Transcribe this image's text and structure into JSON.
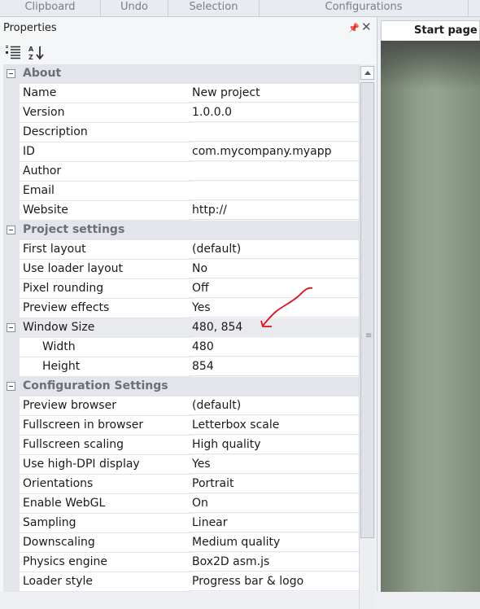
{
  "ribbon": {
    "tabs": [
      {
        "label": "Clipboard"
      },
      {
        "label": "Undo"
      },
      {
        "label": "Selection"
      },
      {
        "label": "Configurations"
      }
    ]
  },
  "properties": {
    "title": "Properties",
    "pin_icon": "pin-icon",
    "close_icon": "close-icon",
    "toolbar": [
      "categorized-view-icon",
      "alphabetical-sort-icon"
    ]
  },
  "groups": {
    "about": {
      "label": "About",
      "rows": [
        {
          "name": "Name",
          "value": "New project"
        },
        {
          "name": "Version",
          "value": "1.0.0.0"
        },
        {
          "name": "Description",
          "value": ""
        },
        {
          "name": "ID",
          "value": "com.mycompany.myapp"
        },
        {
          "name": "Author",
          "value": ""
        },
        {
          "name": "Email",
          "value": ""
        },
        {
          "name": "Website",
          "value": "http://"
        }
      ]
    },
    "project": {
      "label": "Project settings",
      "rows": [
        {
          "name": "First layout",
          "value": "(default)"
        },
        {
          "name": "Use loader layout",
          "value": "No"
        },
        {
          "name": "Pixel rounding",
          "value": "Off"
        },
        {
          "name": "Preview effects",
          "value": "Yes"
        }
      ],
      "window_size": {
        "name": "Window Size",
        "value": "480, 854"
      },
      "sub_rows": [
        {
          "name": "Width",
          "value": "480"
        },
        {
          "name": "Height",
          "value": "854"
        }
      ]
    },
    "config": {
      "label": "Configuration Settings",
      "rows": [
        {
          "name": "Preview browser",
          "value": "(default)"
        },
        {
          "name": "Fullscreen in browser",
          "value": "Letterbox scale"
        },
        {
          "name": "Fullscreen scaling",
          "value": "High quality"
        },
        {
          "name": "Use high-DPI display",
          "value": "Yes"
        },
        {
          "name": "Orientations",
          "value": "Portrait"
        },
        {
          "name": "Enable WebGL",
          "value": "On"
        },
        {
          "name": "Sampling",
          "value": "Linear"
        },
        {
          "name": "Downscaling",
          "value": "Medium quality"
        },
        {
          "name": "Physics engine",
          "value": "Box2D asm.js"
        },
        {
          "name": "Loader style",
          "value": "Progress bar & logo"
        }
      ]
    }
  },
  "layout_view": {
    "tab_label": "Start page"
  },
  "annotation": {
    "arrow_color": "#e0121a"
  }
}
